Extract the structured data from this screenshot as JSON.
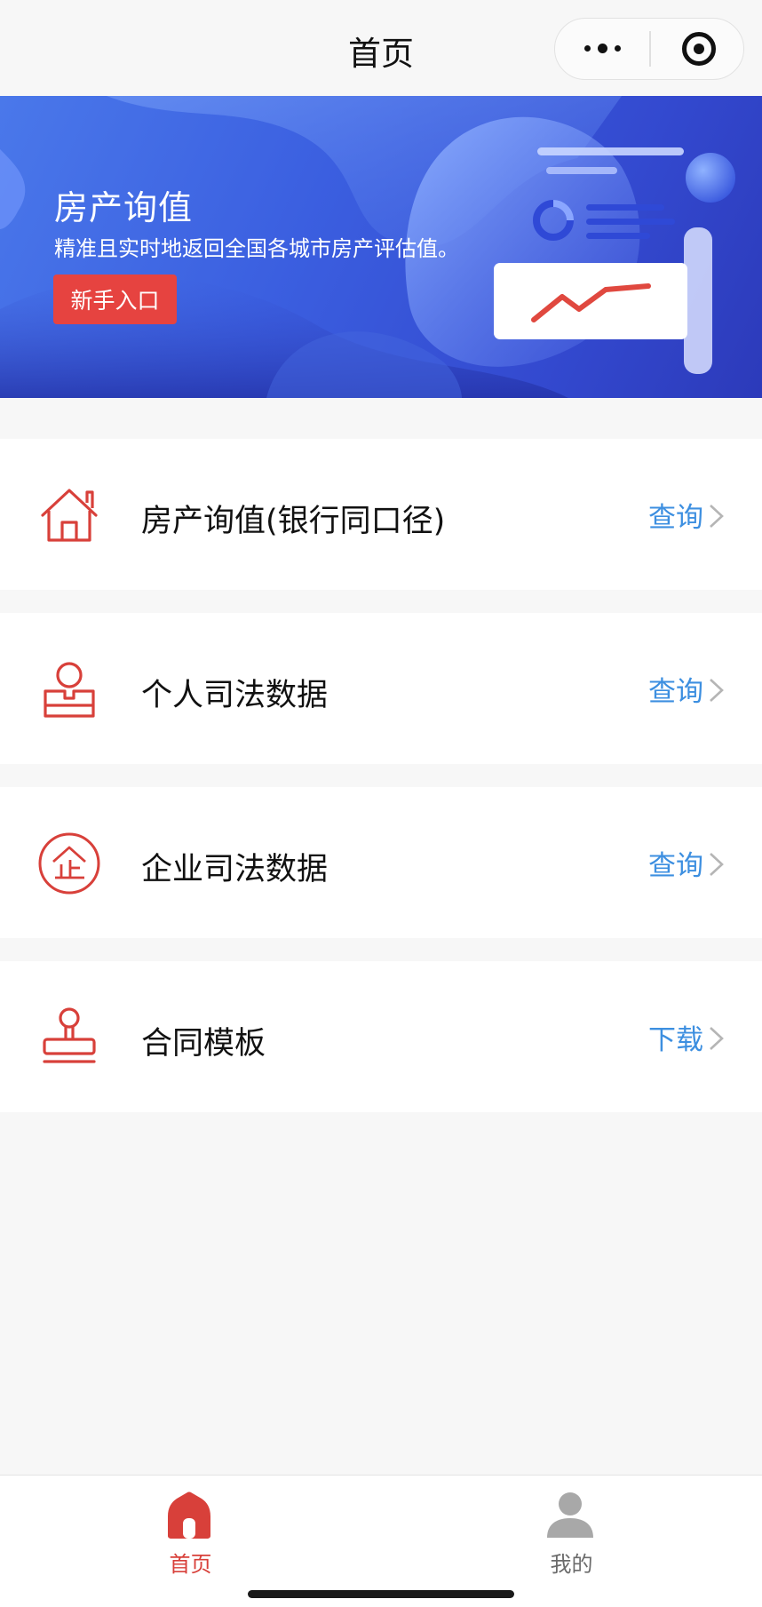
{
  "nav": {
    "title": "首页",
    "capsule": {
      "more_icon": "more-dots-icon",
      "close_icon": "target-circle-icon"
    }
  },
  "banner": {
    "title": "房产询值",
    "subtitle": "精准且实时地返回全国各城市房产评估值。",
    "button_label": "新手入口",
    "colors": {
      "bg_start": "#4a78ea",
      "bg_end": "#2c3aba",
      "button": "#e64340"
    }
  },
  "services": [
    {
      "icon": "house-icon",
      "label": "房产询值(银行同口径)",
      "action": "查询"
    },
    {
      "icon": "person-icon",
      "label": "个人司法数据",
      "action": "查询"
    },
    {
      "icon": "enterprise-icon",
      "label": "企业司法数据",
      "action": "查询"
    },
    {
      "icon": "stamp-icon",
      "label": "合同模板",
      "action": "下载"
    }
  ],
  "tabbar": {
    "items": [
      {
        "label": "首页",
        "icon": "home-icon",
        "active": true
      },
      {
        "label": "我的",
        "icon": "user-icon",
        "active": false
      }
    ]
  },
  "colors": {
    "accent_red": "#d8403a",
    "link_blue": "#3d8fe0",
    "page_bg": "#f7f7f7"
  }
}
